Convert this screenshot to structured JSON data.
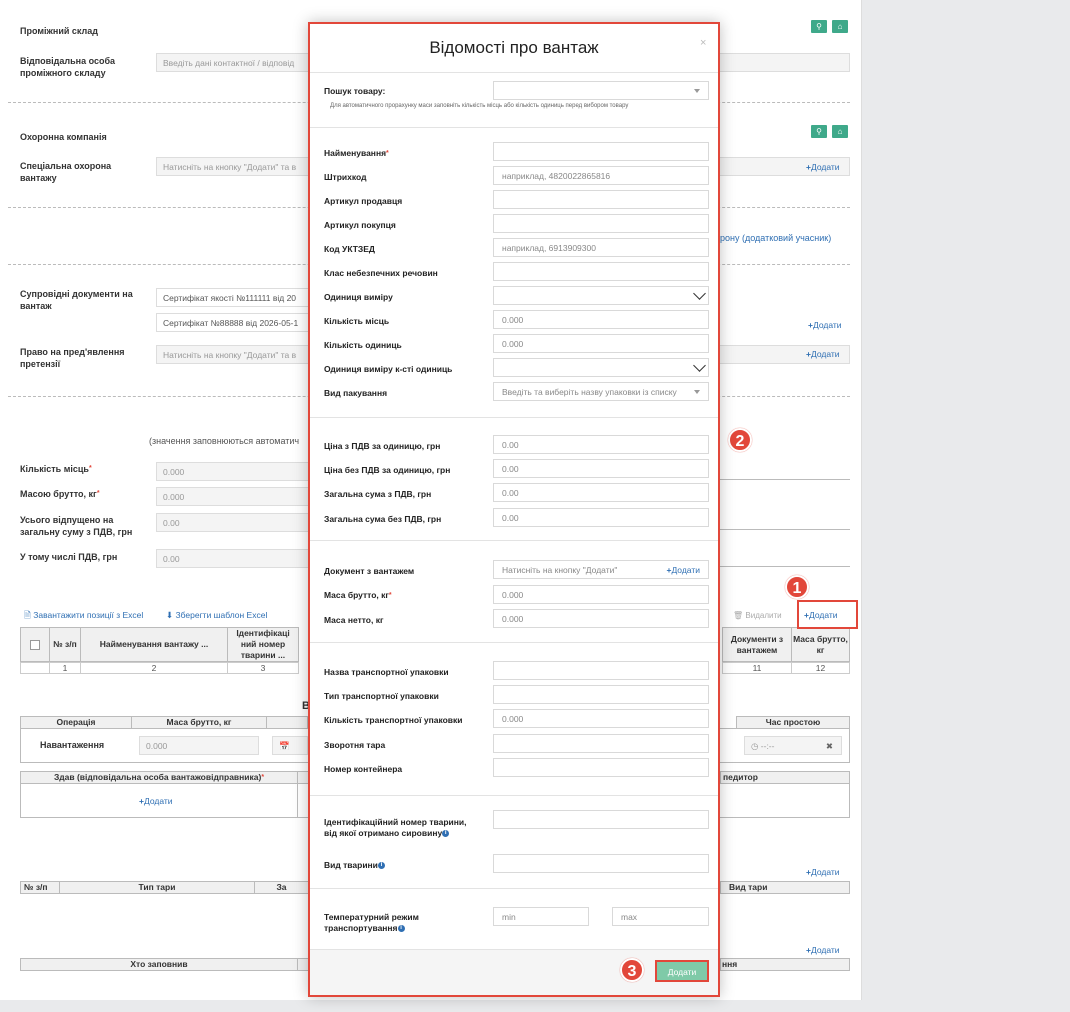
{
  "bg": {
    "intermediate_warehouse_label": "Проміжний склад",
    "responsible_intermediate_label": "Відповідальна особа проміжного складу",
    "responsible_intermediate_placeholder": "Введіть дані контактної / відповід",
    "security_company_label": "Охоронна компанія",
    "special_security_label": "Спеціальна охорона вантажу",
    "press_add_placeholder": "Натисніть на кнопку \"Додати\" та в",
    "add_label": "Додати",
    "additional_party_link": "рону (додатковий учасник)",
    "accompanying_docs_label": "Супровідні документи на вантаж",
    "doc_1": "Сертифікат якості №111111 від 20",
    "doc_2": "Сертифікат №88888 від 2026-05-1",
    "claim_right_label": "Право на пред'явлення претензії",
    "auto_calc_note": "(значення заповнюються автоматич",
    "places_count_label": "Кількість місць",
    "gross_mass_label": "Масою брутто, кг",
    "total_vat_label": "Усього відпущено на загальну суму з ПДВ, грн",
    "vat_label": "У тому числі ПДВ, грн",
    "zero3": "0.000",
    "zero2": "0.00",
    "load_excel": "Завантажити позиції з Excel",
    "save_template": "Зберегти шаблон Excel",
    "delete_label": "Видалити",
    "table_headers": {
      "num": "№ з/п",
      "cargo_name": "Найменування вантажу ...",
      "animal_id": "Ідентифікаці ний номер тварини ...",
      "docs_with_cargo": "Документи з вантажем",
      "gross_mass": "Маса брутто, кг"
    },
    "col_nums": [
      "1",
      "2",
      "3",
      "11",
      "12"
    ],
    "section_letter": "В",
    "ops_headers": {
      "operation": "Операція",
      "gross_mass": "Маса брутто, кг",
      "idle_time": "Час простою"
    },
    "ops_row": {
      "loading": "Навантаження",
      "mass": "0.000",
      "time": "--:--"
    },
    "handed_label": "Здав (відповідальна особа вантажовідправника)",
    "forwarder_label": "педитор",
    "packaging_headers": {
      "num": "№ з/п",
      "tare_type": "Тип тари",
      "za": "За",
      "tare_kind": "Вид тари"
    },
    "who_filled": "Хто заповнив",
    "nya": "ння"
  },
  "modal": {
    "title": "Відомості про вантаж",
    "close": "×",
    "search_label": "Пошук товару:",
    "search_hint": "Для автоматичного прорахунку маси заповніть кількість місць або кількість одиниць перед вибором товару",
    "fields": {
      "name": "Найменування",
      "barcode": "Штрихкод",
      "barcode_ph": "наприклад, 4820022865816",
      "seller_article": "Артикул продавця",
      "buyer_article": "Артикул покупця",
      "uktzed": "Код УКТЗЕД",
      "uktzed_ph": "наприклад, 6913909300",
      "hazard_class": "Клас небезпечних речовин",
      "unit": "Одиниця виміру",
      "places": "Кількість місць",
      "places_val": "0.000",
      "units": "Кількість одиниць",
      "units_val": "0.000",
      "unit_qty": "Одиниця виміру к-сті одиниць",
      "package_type": "Вид пакування",
      "package_type_ph": "Введіть та виберіть назву упаковки із списку",
      "price_vat": "Ціна з ПДВ за одиницю, грн",
      "price_novat": "Ціна без ПДВ за одиницю, грн",
      "sum_vat": "Загальна сума з ПДВ, грн",
      "sum_novat": "Загальна сума без ПДВ, грн",
      "money_zero": "0.00",
      "doc_with_cargo": "Документ з вантажем",
      "doc_with_cargo_ph": "Натисніть на кнопку \"Додати\"",
      "doc_add": "Додати",
      "gross": "Маса брутто, кг",
      "gross_val": "0.000",
      "net": "Маса нетто, кг",
      "net_val": "0.000",
      "transport_pkg_name": "Назва транспортної упаковки",
      "transport_pkg_type": "Тип транспортної упаковки",
      "transport_pkg_count": "Кількість транспортної упаковки",
      "transport_pkg_count_val": "0.000",
      "return_tare": "Зворотня тара",
      "container_num": "Номер контейнера",
      "animal_id": "Ідентифікаційний номер тварини, від якої отримано сировину",
      "animal_kind": "Вид тварини",
      "temp_mode": "Температурний режим транспортування",
      "min_ph": "min",
      "max_ph": "max"
    },
    "submit": "Додати"
  },
  "markers": [
    "1",
    "2",
    "3"
  ],
  "colors": {
    "accent_red": "#e2473a",
    "green": "#3fa98a",
    "link_blue": "#2f6fb3"
  }
}
